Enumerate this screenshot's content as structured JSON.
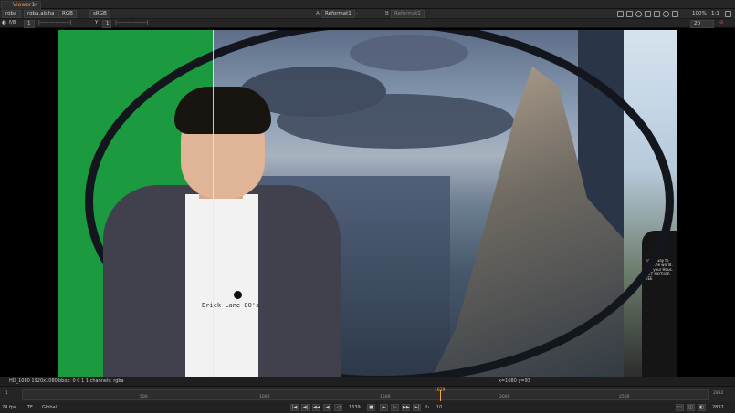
{
  "tab": {
    "title": "Viewer1",
    "close": "×"
  },
  "toolbar1": {
    "channels": "rgba",
    "alpha": "rgba.alpha",
    "colorspace": "RGB",
    "display": "sRGB",
    "a_label": "A",
    "a_input": "Reformat1",
    "b_label": "B",
    "b_input": "Reformat1",
    "zoom": "100%",
    "proxy": "1:1"
  },
  "toolbar2": {
    "fstop": "f/8",
    "frame_field": "1",
    "gain": "1",
    "gamma_label": "Y",
    "gamma": "1",
    "frame_num": "20"
  },
  "info": {
    "format": "HD_1080 1920x1080",
    "bbox": "bbox: 0 0 1 1 channels: rgba",
    "coords": "x=1080 y=93"
  },
  "timeline": {
    "start": "1",
    "end": "2832",
    "ticks": [
      "500",
      "1000",
      "1500",
      "2000",
      "2500"
    ],
    "current": "1639"
  },
  "transport": {
    "fps": "24 fps",
    "tf": "TF",
    "range": "Global",
    "current_frame": "1639",
    "step": "10",
    "end_frame": "2832"
  },
  "content": {
    "shirt_text": "Brick Lane 80's",
    "bg_shirt_text": "has a way to tour the world. see your Hous. GET MOTHER TEE"
  },
  "colors": {
    "accent": "#f3a54d",
    "green_screen": "#1c9a3f"
  }
}
